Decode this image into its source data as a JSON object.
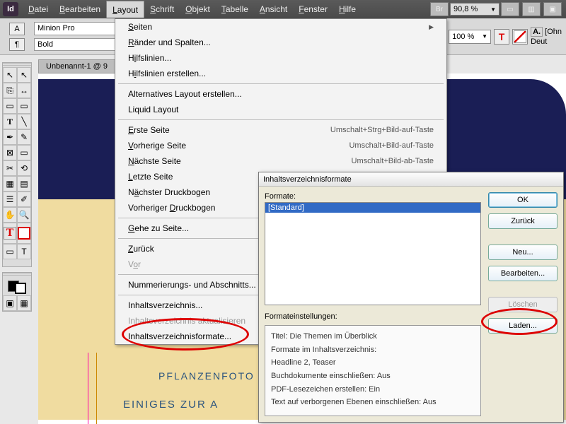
{
  "app": {
    "id": "Id"
  },
  "menubar": {
    "items": [
      "Datei",
      "Bearbeiten",
      "Layout",
      "Schrift",
      "Objekt",
      "Tabelle",
      "Ansicht",
      "Fenster",
      "Hilfe"
    ],
    "open_index": 2,
    "br_label": "Br",
    "zoom": "90,8 %"
  },
  "toolbar": {
    "font": "Minion Pro",
    "weight": "Bold",
    "percent": "100 %",
    "ohn_label": "[Ohn",
    "deut_label": "Deut"
  },
  "doc_tab": "Unbenannt-1 @ 9",
  "dropdown": {
    "groups": [
      [
        {
          "label": "Seiten",
          "arrow": true
        },
        {
          "label": "Ränder und Spalten..."
        },
        {
          "label": "Hilfslinien...",
          "u": [
            0
          ]
        },
        {
          "label": "Hilfslinien erstellen...",
          "u": [
            1
          ]
        }
      ],
      [
        {
          "label": "Alternatives Layout erstellen..."
        },
        {
          "label": "Liquid Layout"
        }
      ],
      [
        {
          "label": "Erste Seite",
          "u": [
            0
          ],
          "shortcut": "Umschalt+Strg+Bild-auf-Taste"
        },
        {
          "label": "Vorherige Seite",
          "u": [
            0
          ],
          "shortcut": "Umschalt+Bild-auf-Taste"
        },
        {
          "label": "Nächste Seite",
          "u": [
            0
          ],
          "shortcut": "Umschalt+Bild-ab-Taste"
        },
        {
          "label": "Letzte Seite",
          "u": [
            0
          ]
        },
        {
          "label": "Nächster Druckbogen",
          "u": [
            9
          ]
        },
        {
          "label": "Vorheriger Druckbogen",
          "u": [
            11
          ]
        }
      ],
      [
        {
          "label": "Gehe zu Seite...",
          "u": [
            0
          ]
        }
      ],
      [
        {
          "label": "Zurück",
          "u": [
            0
          ]
        },
        {
          "label": "Vor",
          "u": [
            2
          ],
          "disabled": true
        }
      ],
      [
        {
          "label": "Nummerierungs- und Abschnitts..."
        }
      ],
      [
        {
          "label": "Inhaltsverzeichnis..."
        },
        {
          "label": "Inhaltsverzeichnis aktualisieren",
          "disabled": true
        },
        {
          "label": "Inhaltsverzeichnisformate..."
        }
      ]
    ]
  },
  "dialog": {
    "title": "Inhaltsverzeichnisformate",
    "formats_label": "Formate:",
    "list_selected": "[Standard]",
    "settings_label": "Formateinstellungen:",
    "settings_lines": [
      "Titel: Die Themen im Überblick",
      "",
      "Formate im Inhaltsverzeichnis:",
      "Headline 2, Teaser",
      "",
      "Buchdokumente einschließen: Aus",
      "PDF-Lesezeichen erstellen: Ein",
      "Text auf verborgenen Ebenen einschließen: Aus"
    ],
    "buttons": {
      "ok": "OK",
      "cancel": "Zurück",
      "new": "Neu...",
      "edit": "Bearbeiten...",
      "delete": "Löschen",
      "load": "Laden..."
    }
  },
  "canvas_text": {
    "line1": "PFLANZENFOTO",
    "line2": "EINIGES ZUR A"
  }
}
